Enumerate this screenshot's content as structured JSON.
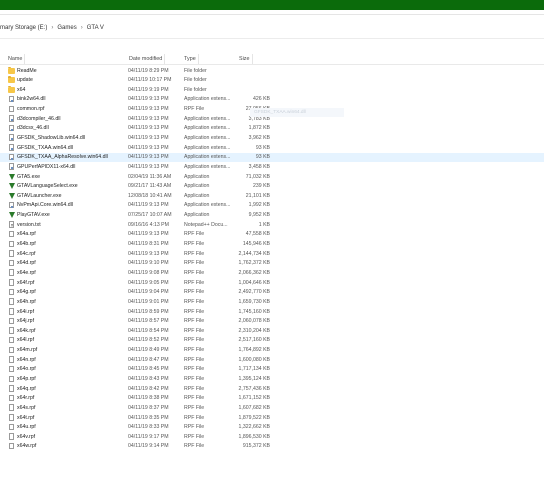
{
  "breadcrumb": [
    "mary Storage (E:)",
    "Games",
    "GTA V"
  ],
  "columns": {
    "name": "Name",
    "date": "Date modified",
    "type": "Type",
    "size": "Size"
  },
  "ghost_text": "GFSDK_TXAA.win64.dll",
  "files": [
    {
      "name": "ReadMe",
      "date": "04/11/19 8:29 PM",
      "type": "File folder",
      "size": "",
      "icon": "folder-icon"
    },
    {
      "name": "update",
      "date": "04/11/19 10:17 PM",
      "type": "File folder",
      "size": "",
      "icon": "folder-icon"
    },
    {
      "name": "x64",
      "date": "04/11/19 9:19 PM",
      "type": "File folder",
      "size": "",
      "icon": "folder-icon"
    },
    {
      "name": "bink2w64.dll",
      "date": "04/11/19 9:13 PM",
      "type": "Application extens...",
      "size": "426 KB",
      "icon": "dll-icon"
    },
    {
      "name": "common.rpf",
      "date": "04/11/19 9:13 PM",
      "type": "RPF File",
      "size": "27,056 KB",
      "icon": "file-icon"
    },
    {
      "name": "d3dcompiler_46.dll",
      "date": "04/11/19 9:13 PM",
      "type": "Application extens...",
      "size": "3,783 KB",
      "icon": "dll-icon"
    },
    {
      "name": "d3dcsx_46.dll",
      "date": "04/11/19 9:13 PM",
      "type": "Application extens...",
      "size": "1,872 KB",
      "icon": "dll-icon"
    },
    {
      "name": "GFSDK_ShadowLib.win64.dll",
      "date": "04/11/19 9:13 PM",
      "type": "Application extens...",
      "size": "3,962 KB",
      "icon": "dll-icon"
    },
    {
      "name": "GFSDK_TXAA.win64.dll",
      "date": "04/11/19 9:13 PM",
      "type": "Application extens...",
      "size": "93 KB",
      "icon": "dll-icon"
    },
    {
      "name": "GFSDK_TXAA_AlphaResolve.win64.dll",
      "date": "04/11/19 9:13 PM",
      "type": "Application extens...",
      "size": "93 KB",
      "icon": "dll-icon",
      "state": "selected"
    },
    {
      "name": "GPUPerfAPIDX11-x64.dll",
      "date": "04/11/19 9:13 PM",
      "type": "Application extens...",
      "size": "3,458 KB",
      "icon": "dll-icon"
    },
    {
      "name": "GTA5.exe",
      "date": "02/04/19 11:36 AM",
      "type": "Application",
      "size": "71,032 KB",
      "icon": "gta-exe-icon"
    },
    {
      "name": "GTAVLanguageSelect.exe",
      "date": "09/21/17 11:43 AM",
      "type": "Application",
      "size": "239 KB",
      "icon": "gta-exe-icon"
    },
    {
      "name": "GTAVLauncher.exe",
      "date": "12/08/18 10:41 AM",
      "type": "Application",
      "size": "21,101 KB",
      "icon": "gta-exe-icon"
    },
    {
      "name": "NvPmApi.Core.win64.dll",
      "date": "04/11/19 9:13 PM",
      "type": "Application extens...",
      "size": "1,992 KB",
      "icon": "dll-icon"
    },
    {
      "name": "PlayGTAV.exe",
      "date": "07/25/17 10:07 AM",
      "type": "Application",
      "size": "9,952 KB",
      "icon": "gta-exe-icon"
    },
    {
      "name": "version.txt",
      "date": "09/16/16 4:13 PM",
      "type": "Notepad++ Docu...",
      "size": "1 KB",
      "icon": "txt-icon"
    },
    {
      "name": "x64a.rpf",
      "date": "04/11/19 9:13 PM",
      "type": "RPF File",
      "size": "47,558 KB",
      "icon": "file-icon"
    },
    {
      "name": "x64b.rpf",
      "date": "04/11/19 8:31 PM",
      "type": "RPF File",
      "size": "145,946 KB",
      "icon": "file-icon"
    },
    {
      "name": "x64c.rpf",
      "date": "04/11/19 9:13 PM",
      "type": "RPF File",
      "size": "2,144,734 KB",
      "icon": "file-icon"
    },
    {
      "name": "x64d.rpf",
      "date": "04/11/19 9:10 PM",
      "type": "RPF File",
      "size": "1,762,372 KB",
      "icon": "file-icon"
    },
    {
      "name": "x64e.rpf",
      "date": "04/11/19 9:08 PM",
      "type": "RPF File",
      "size": "2,066,362 KB",
      "icon": "file-icon"
    },
    {
      "name": "x64f.rpf",
      "date": "04/11/19 9:05 PM",
      "type": "RPF File",
      "size": "1,004,646 KB",
      "icon": "file-icon"
    },
    {
      "name": "x64g.rpf",
      "date": "04/11/19 9:04 PM",
      "type": "RPF File",
      "size": "2,492,770 KB",
      "icon": "file-icon"
    },
    {
      "name": "x64h.rpf",
      "date": "04/11/19 9:01 PM",
      "type": "RPF File",
      "size": "1,659,730 KB",
      "icon": "file-icon"
    },
    {
      "name": "x64i.rpf",
      "date": "04/11/19 8:59 PM",
      "type": "RPF File",
      "size": "1,745,160 KB",
      "icon": "file-icon"
    },
    {
      "name": "x64j.rpf",
      "date": "04/11/19 8:57 PM",
      "type": "RPF File",
      "size": "2,060,078 KB",
      "icon": "file-icon"
    },
    {
      "name": "x64k.rpf",
      "date": "04/11/19 8:54 PM",
      "type": "RPF File",
      "size": "2,310,204 KB",
      "icon": "file-icon"
    },
    {
      "name": "x64l.rpf",
      "date": "04/11/19 8:52 PM",
      "type": "RPF File",
      "size": "2,517,160 KB",
      "icon": "file-icon"
    },
    {
      "name": "x64m.rpf",
      "date": "04/11/19 8:49 PM",
      "type": "RPF File",
      "size": "1,764,892 KB",
      "icon": "file-icon"
    },
    {
      "name": "x64n.rpf",
      "date": "04/11/19 8:47 PM",
      "type": "RPF File",
      "size": "1,600,080 KB",
      "icon": "file-icon"
    },
    {
      "name": "x64o.rpf",
      "date": "04/11/19 8:45 PM",
      "type": "RPF File",
      "size": "1,717,134 KB",
      "icon": "file-icon"
    },
    {
      "name": "x64p.rpf",
      "date": "04/11/19 8:43 PM",
      "type": "RPF File",
      "size": "1,395,124 KB",
      "icon": "file-icon"
    },
    {
      "name": "x64q.rpf",
      "date": "04/11/19 8:42 PM",
      "type": "RPF File",
      "size": "2,757,436 KB",
      "icon": "file-icon"
    },
    {
      "name": "x64r.rpf",
      "date": "04/11/19 8:38 PM",
      "type": "RPF File",
      "size": "1,671,152 KB",
      "icon": "file-icon"
    },
    {
      "name": "x64s.rpf",
      "date": "04/11/19 8:37 PM",
      "type": "RPF File",
      "size": "1,607,682 KB",
      "icon": "file-icon"
    },
    {
      "name": "x64t.rpf",
      "date": "04/11/19 8:35 PM",
      "type": "RPF File",
      "size": "1,879,522 KB",
      "icon": "file-icon"
    },
    {
      "name": "x64u.rpf",
      "date": "04/11/19 8:33 PM",
      "type": "RPF File",
      "size": "1,322,662 KB",
      "icon": "file-icon"
    },
    {
      "name": "x64v.rpf",
      "date": "04/11/19 9:17 PM",
      "type": "RPF File",
      "size": "1,896,530 KB",
      "icon": "file-icon"
    },
    {
      "name": "x64w.rpf",
      "date": "04/11/19 9:14 PM",
      "type": "RPF File",
      "size": "915,372 KB",
      "icon": "file-icon"
    }
  ],
  "colors": {
    "title_bar": "#0b6b0b",
    "selection": "#cce8ff",
    "folder": "#f7c748"
  }
}
